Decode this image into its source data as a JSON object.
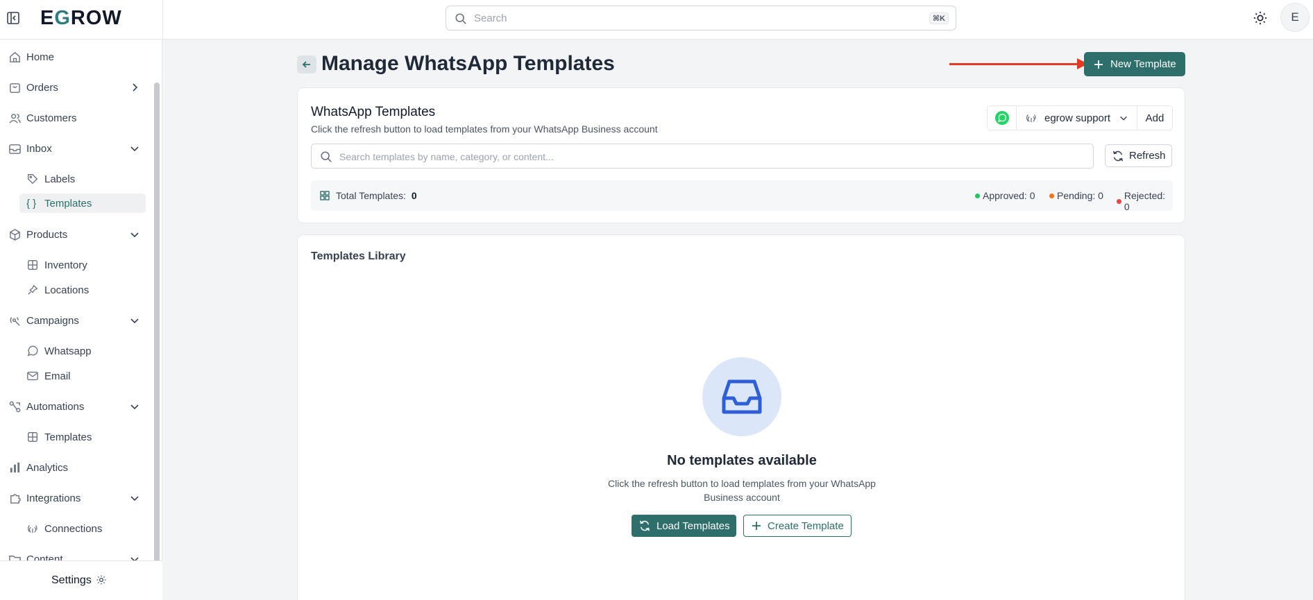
{
  "app": {
    "logo_prefix": "E",
    "logo_accent": "G",
    "logo_suffix": "ROW"
  },
  "search": {
    "placeholder": "Search",
    "shortcut": "⌘K"
  },
  "user": {
    "avatar_initial": "E"
  },
  "sidebar": {
    "items": [
      {
        "label": "Home"
      },
      {
        "label": "Orders"
      },
      {
        "label": "Customers"
      },
      {
        "label": "Inbox"
      },
      {
        "label": "Labels"
      },
      {
        "label": "Templates"
      },
      {
        "label": "Products"
      },
      {
        "label": "Inventory"
      },
      {
        "label": "Locations"
      },
      {
        "label": "Campaigns"
      },
      {
        "label": "Whatsapp"
      },
      {
        "label": "Email"
      },
      {
        "label": "Automations"
      },
      {
        "label": "Templates"
      },
      {
        "label": "Analytics"
      },
      {
        "label": "Integrations"
      },
      {
        "label": "Connections"
      },
      {
        "label": "Content"
      }
    ],
    "settings_label": "Settings"
  },
  "page": {
    "title": "Manage WhatsApp Templates",
    "new_template_label": "New Template"
  },
  "templates_card": {
    "title": "WhatsApp Templates",
    "subtitle": "Click the refresh button to load templates from your WhatsApp Business account",
    "account_name": "egrow support",
    "add_label": "Add",
    "search_placeholder": "Search templates by name, category, or content...",
    "refresh_label": "Refresh",
    "total_label": "Total Templates:",
    "total_value": "0",
    "approved": "Approved: 0",
    "pending": "Pending: 0",
    "rejected": "Rejected: 0"
  },
  "library": {
    "title": "Templates Library",
    "empty_title": "No templates available",
    "empty_subtitle": "Click the refresh button to load templates from your WhatsApp Business account",
    "load_label": "Load Templates",
    "create_label": "Create Template"
  },
  "colors": {
    "brand": "#2e6f6b",
    "arrow": "#e53922",
    "approved": "#22c55e",
    "pending": "#f97316",
    "rejected": "#ef4444"
  }
}
